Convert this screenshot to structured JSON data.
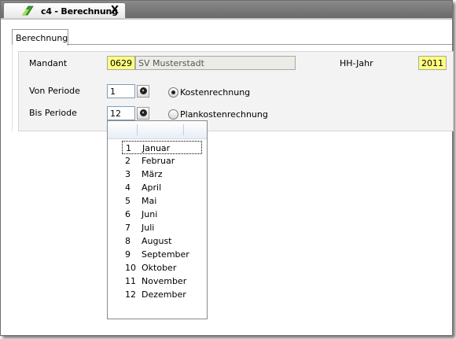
{
  "document_tab": {
    "title": "c4 - Berechnung",
    "close_glyph": "X",
    "icon": "app-document-icon"
  },
  "inner_tab": {
    "label": "Berechnung"
  },
  "form": {
    "mandant_label": "Mandant",
    "mandant_code": "0629",
    "mandant_name": "SV Musterstadt",
    "hh_jahr_label": "HH-Jahr",
    "hh_jahr_value": "2011",
    "von_periode_label": "Von Periode",
    "von_periode_value": "1",
    "bis_periode_label": "Bis Periode",
    "bis_periode_value": "12",
    "radio_kosten": "Kostenrechnung",
    "radio_plan": "Plankostenrechnung",
    "selected_radio": "Kostenrechnung"
  },
  "dropdown": {
    "items": [
      {
        "num": "1",
        "name": "Januar"
      },
      {
        "num": "2",
        "name": "Februar"
      },
      {
        "num": "3",
        "name": "März"
      },
      {
        "num": "4",
        "name": "April"
      },
      {
        "num": "5",
        "name": "Mai"
      },
      {
        "num": "6",
        "name": "Juni"
      },
      {
        "num": "7",
        "name": "Juli"
      },
      {
        "num": "8",
        "name": "August"
      },
      {
        "num": "9",
        "name": "September"
      },
      {
        "num": "10",
        "name": "Oktober"
      },
      {
        "num": "11",
        "name": "November"
      },
      {
        "num": "12",
        "name": "Dezember"
      }
    ],
    "focused_item": "1"
  },
  "colors": {
    "highlight_field": "#ffff80",
    "readonly_field": "#ecece6"
  }
}
